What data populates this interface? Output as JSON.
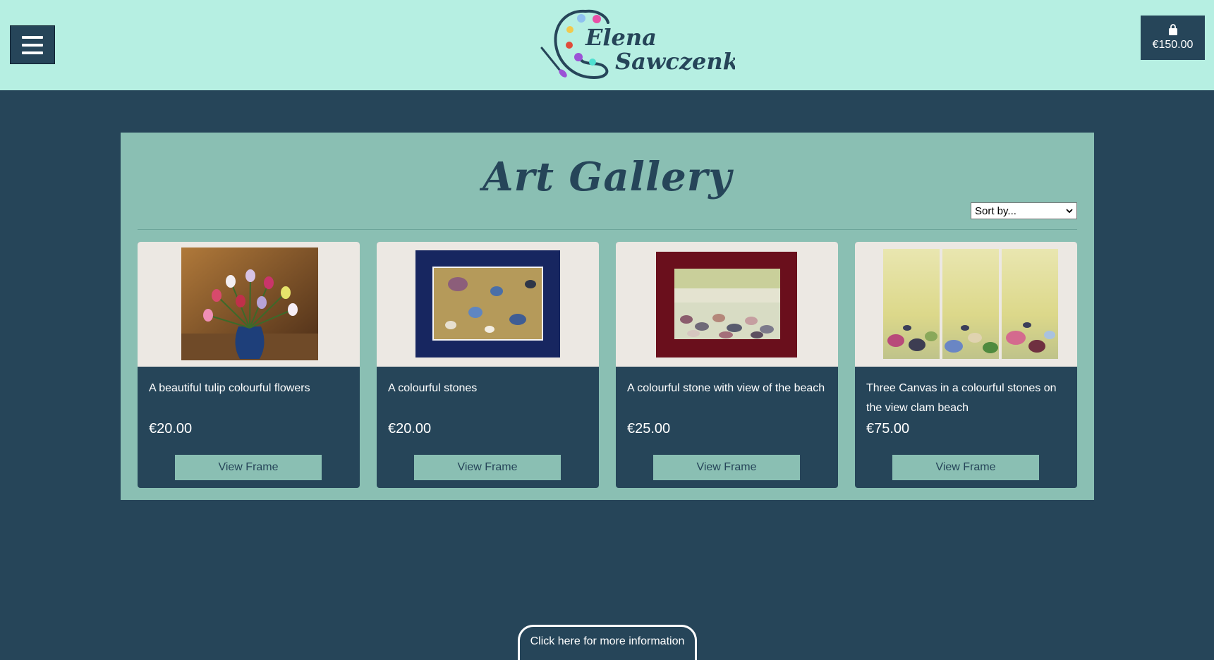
{
  "header": {
    "logo_line1": "Elena",
    "logo_line2": "Sawczenko",
    "menu_icon": "hamburger-icon",
    "cart_icon": "shopping-bag-icon",
    "cart_total": "€150.00"
  },
  "gallery": {
    "title": "Art Gallery",
    "sort_label": "Sort by...",
    "view_label": "View Frame",
    "products": [
      {
        "title": "A beautiful tulip colourful flowers",
        "price": "€20.00"
      },
      {
        "title": "A colourful stones",
        "price": "€20.00"
      },
      {
        "title": "A colourful stone with view of the beach",
        "price": "€25.00"
      },
      {
        "title": "Three Canvas in a colourful stones on the view clam beach",
        "price": "€75.00"
      }
    ]
  },
  "footer": {
    "info_label": "Click here for more information"
  },
  "colors": {
    "header_bg": "#b6efe2",
    "page_bg": "#264559",
    "panel_bg": "#8abfb3",
    "accent": "#264559"
  }
}
